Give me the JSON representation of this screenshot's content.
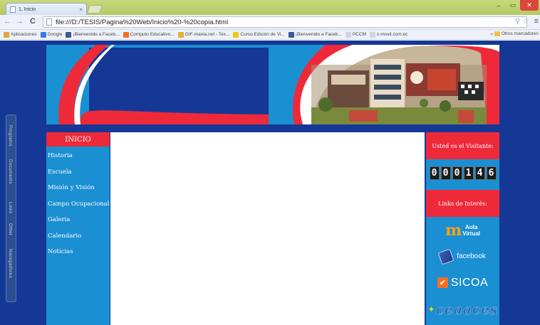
{
  "browser": {
    "tab_title": "1. Inicio",
    "tab_close": "×",
    "window_minimize": "–",
    "window_restore": "▭",
    "window_close": "✕",
    "url": "file:///D:/TESIS/Pagina%20Web/Inicio%20-%20copia.html",
    "back": "←",
    "forward": "→",
    "reload": "C",
    "bookmarks": [
      {
        "label": "Aplicaciones",
        "color": "#e3a43a"
      },
      {
        "label": "Google",
        "color": "#3b78e7"
      },
      {
        "label": "¡Bienvenido a Faceb...",
        "color": "#3b5998"
      },
      {
        "label": "Computo Educativo...",
        "color": "#f36f21"
      },
      {
        "label": "GIF-mania.net - Tex...",
        "color": "#e4b12e"
      },
      {
        "label": "Curso Edición de Vi...",
        "color": "#f0c419"
      },
      {
        "label": "¡Bienvenido a Faceb...",
        "color": "#3b5998"
      },
      {
        "label": "PCCM",
        "color": "#cfd6e2"
      },
      {
        "label": "c-movil.com.ec",
        "color": "#cfd6e2"
      }
    ],
    "bookmarks_overflow": "»",
    "other_bookmarks": "Otros marcadores"
  },
  "side_panel": [
    "Programs",
    "Documents",
    "Links",
    "Other",
    "Navegadores"
  ],
  "nav": {
    "header": "INICIO",
    "items": [
      "Historia",
      "Escuela",
      "Misión y Visión",
      "Campo Ocupacional",
      "Galeria",
      "Calendario",
      "Noticias"
    ]
  },
  "right": {
    "visitor_title": "Usted es el Visitante:",
    "counter": [
      "0",
      "0",
      "0",
      "1",
      "4",
      "6"
    ],
    "links_title": "Links de Interés:",
    "moodle_icon": "m",
    "moodle_label_1": "Aula",
    "moodle_label_2": "Virtual",
    "facebook_label": "facebook",
    "sicoa_icon": "✔",
    "sicoa_label": "SICOA",
    "ceaaces_label": "ceaaces"
  },
  "colors": {
    "page_bg": "#153796",
    "panel_blue": "#1a8fd2",
    "accent_red": "#ee2a3a"
  }
}
